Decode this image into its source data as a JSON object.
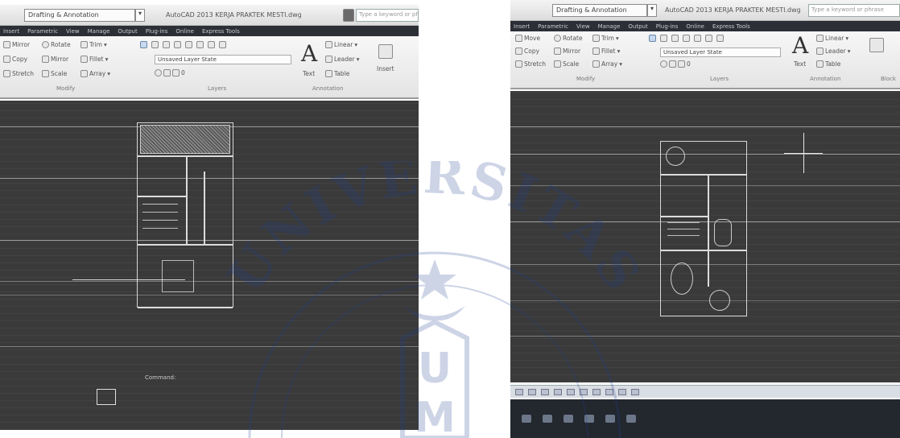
{
  "left_screenshot": {
    "workspace": "Drafting & Annotation",
    "title": "AutoCAD 2013  KERJA PRAKTEK MESTI.dwg",
    "search_placeholder": "Type a keyword or phrase",
    "tabs": [
      "Insert",
      "Parametric",
      "View",
      "Manage",
      "Output",
      "Plug-ins",
      "Online",
      "Express Tools"
    ],
    "modify_tools": {
      "mirror": "Mirror",
      "rotate": "Rotate",
      "trim": "Trim",
      "copy": "Copy",
      "mirror2": "Mirror",
      "fillet": "Fillet",
      "stretch": "Stretch",
      "scale": "Scale",
      "array": "Array"
    },
    "layer_state": "Unsaved Layer State",
    "layer_current": "0",
    "text_label": "Text",
    "linear_label": "Linear",
    "leader_label": "Leader",
    "table_label": "Table",
    "insert_label": "Insert",
    "panels": {
      "modify": "Modify",
      "layers": "Layers",
      "annotation": "Annotation"
    },
    "command_line": "Command:"
  },
  "right_screenshot": {
    "workspace": "Drafting & Annotation",
    "title": "AutoCAD 2013  KERJA PRAKTEK MESTI.dwg",
    "search_placeholder": "Type a keyword or phrase",
    "tabs": [
      "Insert",
      "Parametric",
      "View",
      "Manage",
      "Output",
      "Plug-ins",
      "Online",
      "Express Tools"
    ],
    "modify_tools": {
      "move": "Move",
      "rotate": "Rotate",
      "trim": "Trim",
      "copy": "Copy",
      "mirror": "Mirror",
      "fillet": "Fillet",
      "stretch": "Stretch",
      "scale": "Scale",
      "array": "Array"
    },
    "layer_state": "Unsaved Layer State",
    "layer_current": "0",
    "text_label": "Text",
    "linear_label": "Linear",
    "leader_label": "Leader",
    "table_label": "Table",
    "panels": {
      "modify": "Modify",
      "layers": "Layers",
      "annotation": "Annotation",
      "block": "Block"
    }
  },
  "watermark": {
    "arc_text": "UNIVERSITAS",
    "letters": [
      "U",
      "M"
    ],
    "color": "#1f3f8f"
  }
}
